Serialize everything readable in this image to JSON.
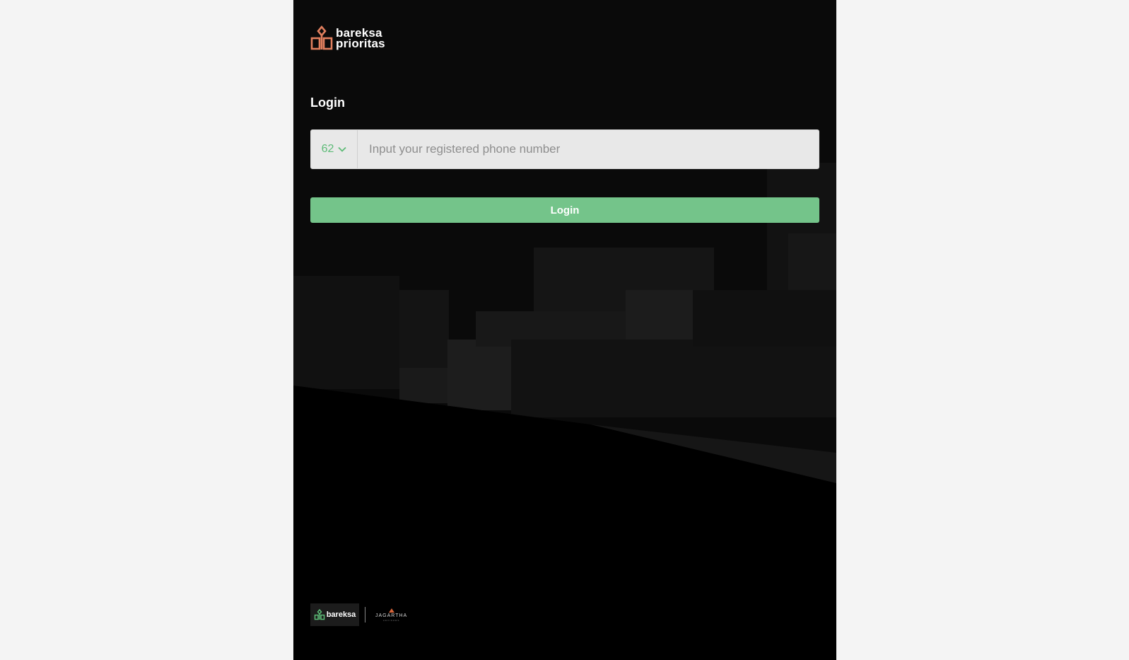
{
  "brand": {
    "line1": "bareksa",
    "line2": "prioritas",
    "mark_color": "#e07f5e"
  },
  "login": {
    "title": "Login",
    "country_code": "62",
    "phone_placeholder": "Input your registered phone number",
    "button_label": "Login"
  },
  "footer": {
    "bareksa_label": "bareksa",
    "jagartha_label": "JAGARTHA",
    "jagartha_sub": "ADVISORS"
  },
  "colors": {
    "page_background": "#f4f4f4",
    "panel_background": "#0a0a0a",
    "accent_green": "#74c48a",
    "country_code_green": "#5dbb77",
    "input_background": "#e8e8e8"
  },
  "icons": [
    "bareksa-prioritas-logo-icon",
    "chevron-down-icon",
    "bareksa-logo-icon",
    "jagartha-logo-icon"
  ]
}
